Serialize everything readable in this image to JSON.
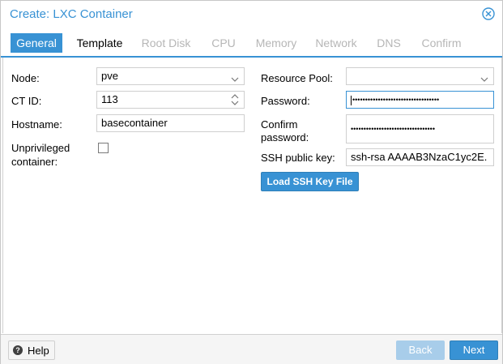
{
  "window": {
    "title": "Create: LXC Container"
  },
  "tabs": [
    {
      "label": "General",
      "state": "active"
    },
    {
      "label": "Template",
      "state": "enabled"
    },
    {
      "label": "Root Disk",
      "state": "disabled"
    },
    {
      "label": "CPU",
      "state": "disabled"
    },
    {
      "label": "Memory",
      "state": "disabled"
    },
    {
      "label": "Network",
      "state": "disabled"
    },
    {
      "label": "DNS",
      "state": "disabled"
    },
    {
      "label": "Confirm",
      "state": "disabled"
    }
  ],
  "left": {
    "node": {
      "label": "Node:",
      "value": "pve"
    },
    "ctid": {
      "label": "CT ID:",
      "value": "113"
    },
    "hostname": {
      "label": "Hostname:",
      "value": "basecontainer"
    },
    "unprivileged": {
      "label_line1": "Unprivileged",
      "label_line2": "container:",
      "checked": false
    }
  },
  "right": {
    "pool": {
      "label": "Resource Pool:",
      "value": ""
    },
    "password": {
      "label": "Password:",
      "value": "••••••••••••••••••••••••••••••••••"
    },
    "confirm": {
      "label_line1": "Confirm",
      "label_line2": "password:",
      "value": "•••••••••••••••••••••••••••••••••"
    },
    "ssh": {
      "label": "SSH public key:",
      "value": "ssh-rsa AAAAB3NzaC1yc2E."
    },
    "load_button": "Load SSH Key File"
  },
  "footer": {
    "help": "Help",
    "back": "Back",
    "next": "Next"
  },
  "colors": {
    "accent": "#3892d4",
    "disabled_button": "#a8cdea",
    "disabled_tab_text": "#b6b6b6"
  }
}
